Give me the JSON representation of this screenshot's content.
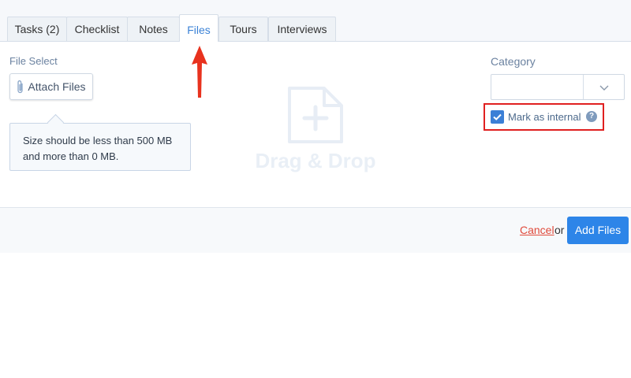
{
  "tabs": [
    {
      "label": "Tasks (2)"
    },
    {
      "label": "Checklist"
    },
    {
      "label": "Notes"
    },
    {
      "label": "Files",
      "active": true
    },
    {
      "label": "Tours"
    },
    {
      "label": "Interviews"
    }
  ],
  "file_select": {
    "label": "File Select",
    "attach_button": "Attach Files",
    "tooltip": "Size should be less than 500 MB and more than 0 MB."
  },
  "dropzone": {
    "text": "Drag & Drop",
    "icon": "file-plus-icon"
  },
  "category": {
    "label": "Category",
    "value": "",
    "options_icon": "chevron-down-icon"
  },
  "internal": {
    "label": "Mark as internal",
    "checked": true,
    "help_icon": "?"
  },
  "footer": {
    "cancel": "Cancel",
    "or": "or",
    "add_files": "Add Files"
  },
  "colors": {
    "accent": "#2d85e8",
    "active_tab_text": "#3b82d6",
    "cancel": "#e04a3b",
    "highlight": "#e02020",
    "annotation_arrow": "#e8321e"
  }
}
